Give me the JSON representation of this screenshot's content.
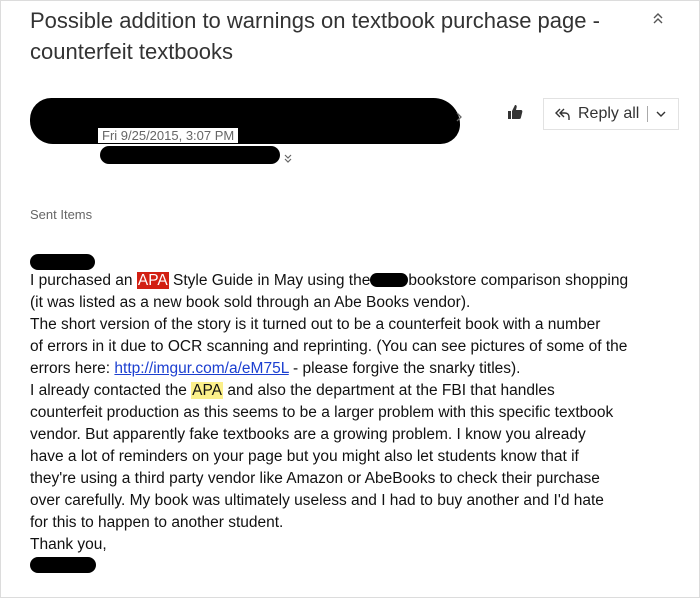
{
  "email": {
    "subject": "Possible addition to warnings on textbook purchase page - counterfeit textbooks",
    "date": "Fri 9/25/2015, 3:07 PM",
    "folder": "Sent Items"
  },
  "actions": {
    "reply_all_label": "Reply all"
  },
  "icons": {
    "collapse": "double-chevron-up-icon",
    "like": "thumbs-up-icon",
    "reply_all": "reply-all-icon",
    "dropdown": "chevron-down-icon",
    "sender_expand": "chevron-right-icon",
    "recipients_expand": "double-chevron-down-icon"
  },
  "body": {
    "line1_a": "I purchased an ",
    "line1_apa": "APA",
    "line1_b": " Style Guide in May using the",
    "line1_c": "bookstore comparison shopping",
    "line2": "(it was listed as a new book sold through an Abe Books vendor).",
    "line3": "The short version of the story is it turned out to be a counterfeit book with a number",
    "line4": "of errors in it due to OCR scanning and reprinting. (You can see pictures of some of the",
    "line5_a": "errors here: ",
    "line5_link": "http://imgur.com/a/eM75L",
    "line5_b": " - please forgive the snarky titles).",
    "line6_a": "I already contacted the ",
    "line6_apa": "APA",
    "line6_b": " and also the department at the FBI that handles",
    "line7": "counterfeit production as this seems to be a larger problem with this specific textbook",
    "line8": "vendor.  But apparently fake textbooks are a growing problem.  I know you already",
    "line9": "have a lot of reminders on your page but you might also let students know that if",
    "line10": "they're using a third party vendor like Amazon or AbeBooks to check their purchase",
    "line11": "over carefully.  My book was ultimately useless and I had to buy another and I'd hate",
    "line12": "for this to happen to another student.",
    "line13": "Thank you,"
  },
  "colors": {
    "highlight_red": "#d21f12",
    "highlight_yellow": "#fcf08a",
    "link": "#1c3fd0"
  }
}
